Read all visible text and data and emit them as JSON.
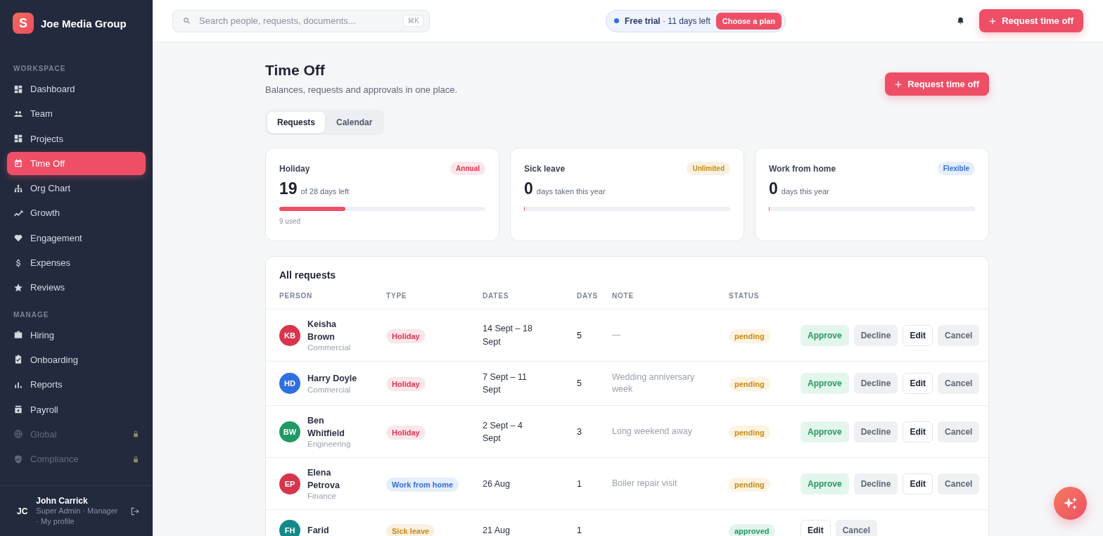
{
  "brand": {
    "logo_letter": "S",
    "name": "Joe Media Group"
  },
  "sidebar": {
    "sections": [
      {
        "title": "WORKSPACE",
        "items": [
          {
            "label": "Dashboard",
            "selected": false,
            "locked": false
          },
          {
            "label": "Team",
            "selected": false,
            "locked": false
          },
          {
            "label": "Projects",
            "selected": false,
            "locked": false
          },
          {
            "label": "Time Off",
            "selected": true,
            "locked": false
          },
          {
            "label": "Org Chart",
            "selected": false,
            "locked": false
          },
          {
            "label": "Growth",
            "selected": false,
            "locked": false
          },
          {
            "label": "Engagement",
            "selected": false,
            "locked": false
          },
          {
            "label": "Expenses",
            "selected": false,
            "locked": false
          },
          {
            "label": "Reviews",
            "selected": false,
            "locked": false
          }
        ]
      },
      {
        "title": "MANAGE",
        "items": [
          {
            "label": "Hiring",
            "selected": false,
            "locked": false
          },
          {
            "label": "Onboarding",
            "selected": false,
            "locked": false
          },
          {
            "label": "Reports",
            "selected": false,
            "locked": false
          },
          {
            "label": "Payroll",
            "selected": false,
            "locked": false
          },
          {
            "label": "Global",
            "selected": false,
            "locked": true
          },
          {
            "label": "Compliance",
            "selected": false,
            "locked": true
          }
        ]
      }
    ],
    "user": {
      "initials": "JC",
      "name": "John Carrick",
      "role": "Super Admin · Manager · My profile"
    }
  },
  "topbar": {
    "search_placeholder": "Search people, requests, documents...",
    "shortcut": "⌘K",
    "trial_label": "Free trial",
    "trial_text": " · 11 days left",
    "plan_button": "Choose a plan",
    "request_button": "Request time off"
  },
  "page": {
    "title": "Time Off",
    "subtitle": "Balances, requests and approvals in one place.",
    "request_button": "Request time off"
  },
  "tabs": [
    {
      "label": "Requests",
      "selected": true
    },
    {
      "label": "Calendar",
      "selected": false
    }
  ],
  "balances": [
    {
      "title": "Holiday",
      "tag": "Annual",
      "color": "#e0314f",
      "value": "19",
      "unit": "of 28 days left",
      "level": 0.32,
      "note": "9 used"
    },
    {
      "title": "Sick leave",
      "tag": "Unlimited",
      "color": "#c98a12",
      "value": "0",
      "unit": "days taken this year",
      "level": 0
    },
    {
      "title": "Work from home",
      "tag": "Flexible",
      "color": "#2f6fe0",
      "value": "0",
      "unit": "days this year",
      "level": 0
    }
  ],
  "table": {
    "title": "All requests",
    "columns": [
      "PERSON",
      "TYPE",
      "DATES",
      "DAYS",
      "NOTE",
      "STATUS"
    ],
    "rows": [
      {
        "initials": "KB",
        "color": "#d8344d",
        "name": "Keisha Brown",
        "team": "Commercial",
        "type": {
          "label": "Holiday",
          "color": "#e0314f"
        },
        "dates": "14 Sept – 18 Sept",
        "days": "5",
        "note": "—",
        "status": {
          "label": "pending",
          "kind": "pending"
        },
        "actions": [
          {
            "label": "Approve",
            "kind": "approve"
          },
          {
            "label": "Decline",
            "kind": "neutral"
          },
          {
            "label": "Edit",
            "kind": "outline"
          },
          {
            "label": "Cancel",
            "kind": "neutral"
          }
        ]
      },
      {
        "initials": "HD",
        "color": "#2f6fe0",
        "name": "Harry Doyle",
        "team": "Commercial",
        "type": {
          "label": "Holiday",
          "color": "#e0314f"
        },
        "dates": "7 Sept – 11 Sept",
        "days": "5",
        "note": "Wedding anniversary week",
        "status": {
          "label": "pending",
          "kind": "pending"
        },
        "actions": [
          {
            "label": "Approve",
            "kind": "approve"
          },
          {
            "label": "Decline",
            "kind": "neutral"
          },
          {
            "label": "Edit",
            "kind": "outline"
          },
          {
            "label": "Cancel",
            "kind": "neutral"
          }
        ]
      },
      {
        "initials": "BW",
        "color": "#1f9a64",
        "name": "Ben Whitfield",
        "team": "Engineering",
        "type": {
          "label": "Holiday",
          "color": "#e0314f"
        },
        "dates": "2 Sept – 4 Sept",
        "days": "3",
        "note": "Long weekend away",
        "status": {
          "label": "pending",
          "kind": "pending"
        },
        "actions": [
          {
            "label": "Approve",
            "kind": "approve"
          },
          {
            "label": "Decline",
            "kind": "neutral"
          },
          {
            "label": "Edit",
            "kind": "outline"
          },
          {
            "label": "Cancel",
            "kind": "neutral"
          }
        ]
      },
      {
        "initials": "EP",
        "color": "#d8344d",
        "name": "Elena Petrova",
        "team": "Finance",
        "type": {
          "label": "Work from home",
          "color": "#2f6fe0"
        },
        "dates": "26 Aug",
        "days": "1",
        "note": "Boiler repair visit",
        "status": {
          "label": "pending",
          "kind": "pending"
        },
        "actions": [
          {
            "label": "Approve",
            "kind": "approve"
          },
          {
            "label": "Decline",
            "kind": "neutral"
          },
          {
            "label": "Edit",
            "kind": "outline"
          },
          {
            "label": "Cancel",
            "kind": "neutral"
          }
        ]
      },
      {
        "initials": "FH",
        "color": "#138a8a",
        "name": "Farid",
        "type": {
          "label": "Sick leave",
          "color": "#c98a12"
        },
        "dates": "21 Aug",
        "days": "1",
        "status": {
          "label": "approved",
          "kind": "approved"
        },
        "actions": [
          {
            "label": "Edit",
            "kind": "outline"
          },
          {
            "label": "Cancel",
            "kind": "neutral"
          }
        ]
      }
    ]
  }
}
